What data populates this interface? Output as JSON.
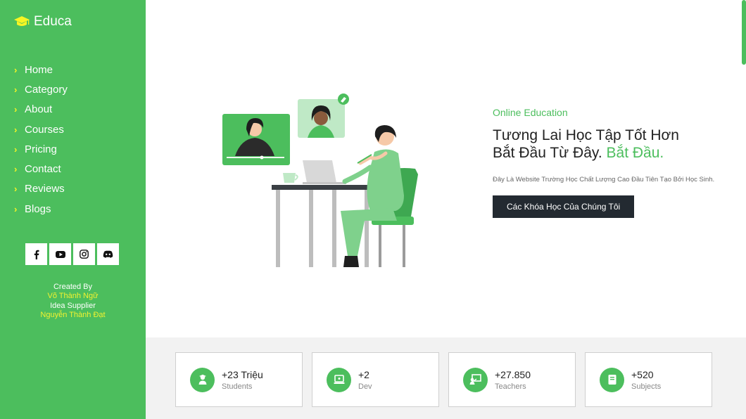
{
  "brand": {
    "name": "Educa",
    "icon": "graduation-cap-icon"
  },
  "nav": [
    {
      "label": "Home"
    },
    {
      "label": "Category"
    },
    {
      "label": "About"
    },
    {
      "label": "Courses"
    },
    {
      "label": "Pricing"
    },
    {
      "label": "Contact"
    },
    {
      "label": "Reviews"
    },
    {
      "label": "Blogs"
    }
  ],
  "socials": [
    "facebook-icon",
    "youtube-icon",
    "instagram-icon",
    "discord-icon"
  ],
  "credits": {
    "created_by": "Created By",
    "author": "Võ Thành Ngữ",
    "idea": "Idea Supplier",
    "supplier": "Nguyễn Thành Đạt"
  },
  "hero": {
    "eyebrow": "Online Education",
    "headline_line1": "Tương Lai Học Tập Tốt Hơn",
    "headline_line2": "Bắt Đầu Từ Đây.",
    "headline_accent": "Bắt Đầu.",
    "description": "Đây Là Website Trường Học Chất Lượng Cao Đầu Tiên Tạo Bởi Học Sinh.",
    "cta": "Các Khóa Học Của Chúng Tôi"
  },
  "stats": [
    {
      "value": "+23 Triệu",
      "label": "Students",
      "icon": "user-graduate-icon"
    },
    {
      "value": "+2",
      "label": "Dev",
      "icon": "laptop-icon"
    },
    {
      "value": "+27.850",
      "label": "Teachers",
      "icon": "teacher-board-icon"
    },
    {
      "value": "+520",
      "label": "Subjects",
      "icon": "book-icon"
    }
  ],
  "colors": {
    "primary": "#4cbe5d",
    "accent_yellow": "#f7f523",
    "dark": "#232a31"
  }
}
